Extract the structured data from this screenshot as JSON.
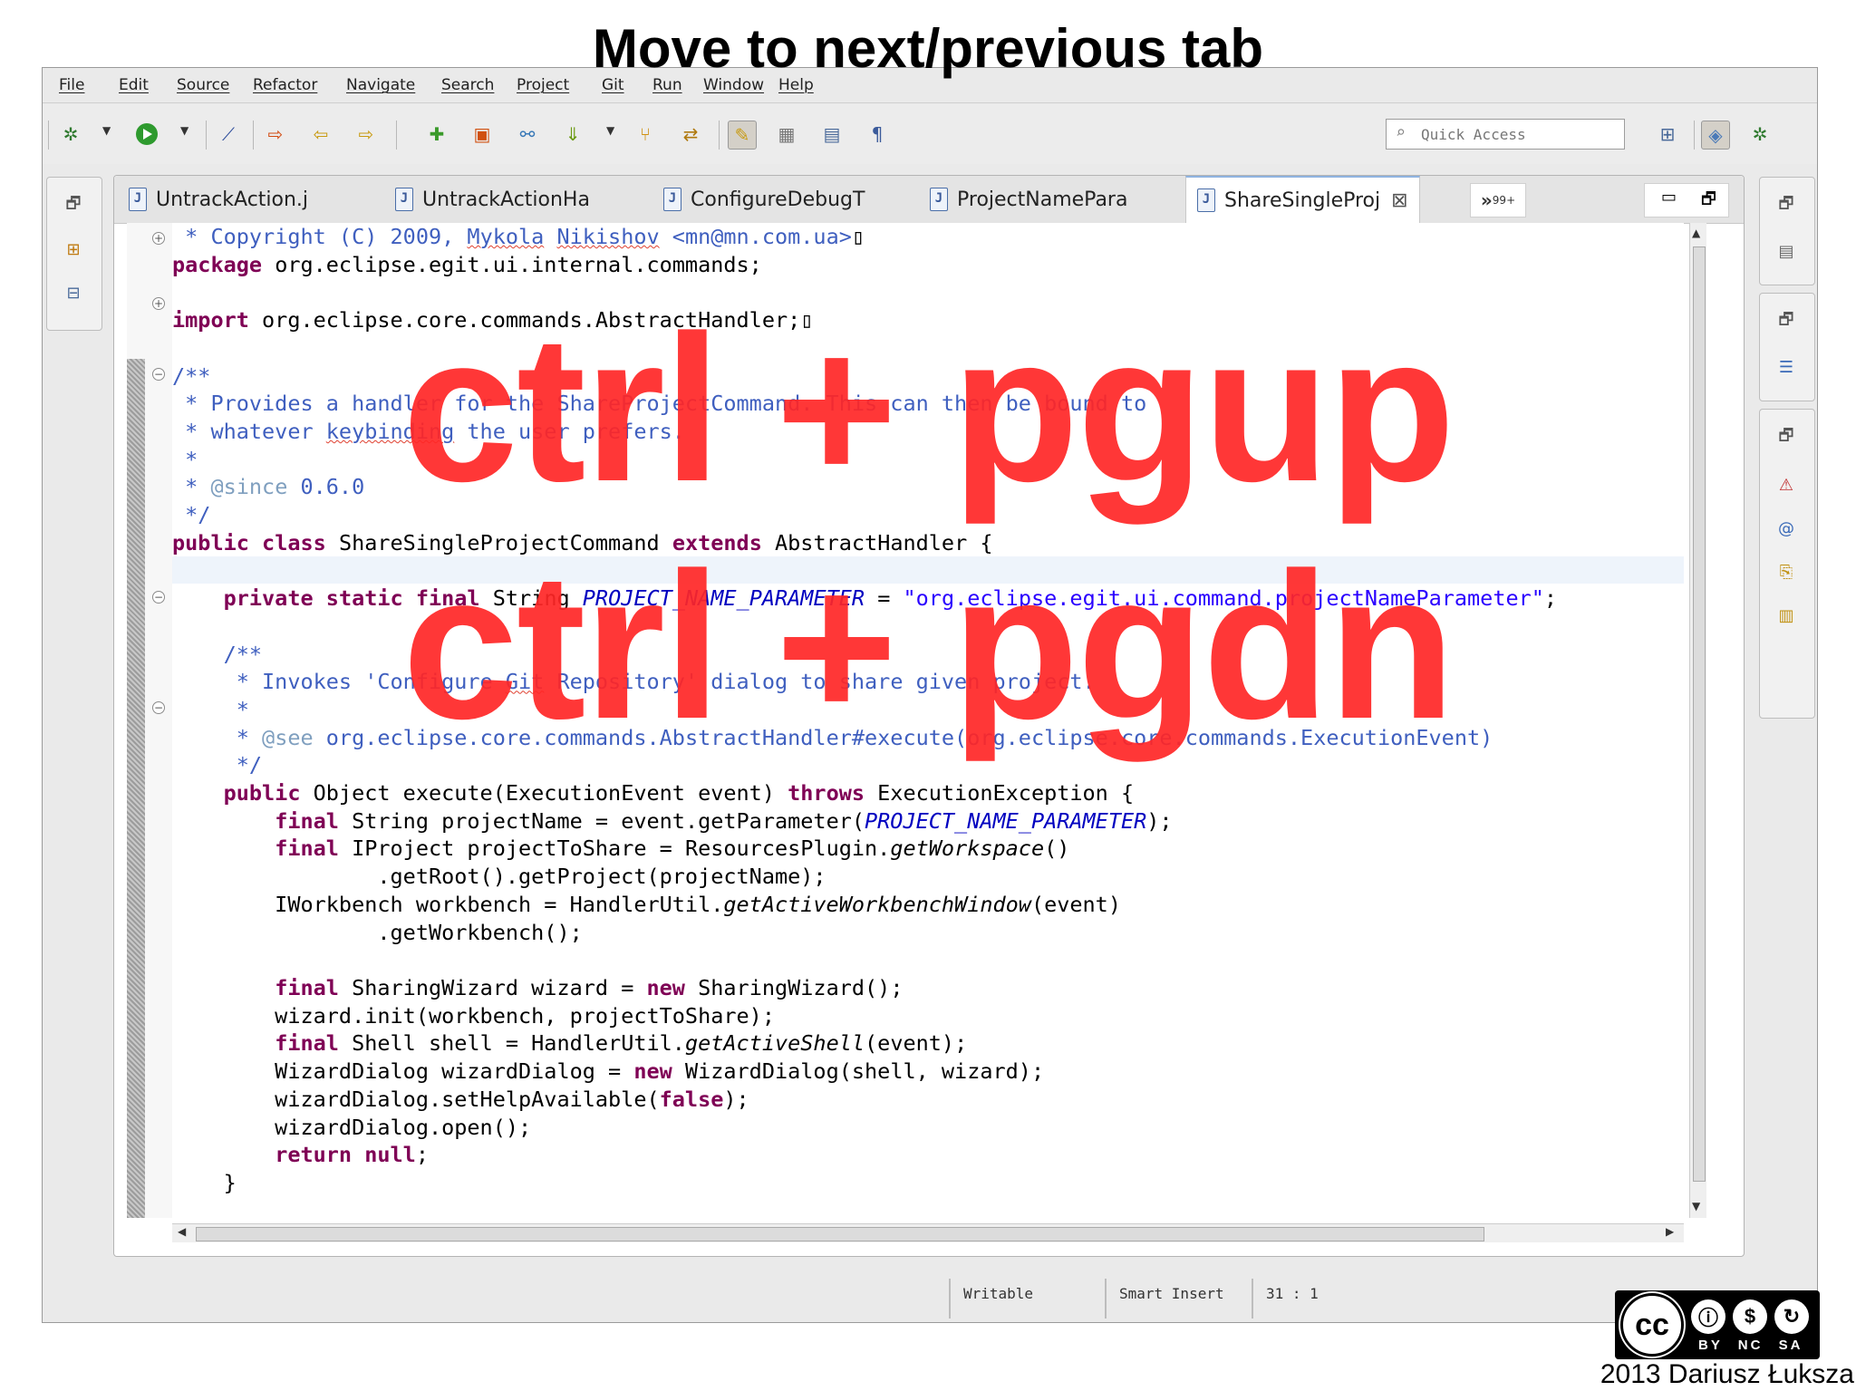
{
  "slide_title": "Move to next/previous tab",
  "menu": [
    "File",
    "Edit",
    "Source",
    "Refactor",
    "Navigate",
    "Search",
    "Project",
    "Git",
    "Run",
    "Window",
    "Help"
  ],
  "toolbar": {
    "quick_access_placeholder": "Quick Access",
    "icons": [
      "debug-icon",
      "run-icon",
      "skip-breakpoints-icon",
      "open-type-icon",
      "new-class-icon",
      "new-package-icon",
      "new-icon",
      "git-icon",
      "search-icon",
      "toggle-mark-occurrences-icon",
      "block-selection-icon",
      "show-whitespace-icon",
      "pilcrow-icon"
    ]
  },
  "tabs": [
    {
      "label": "UntrackAction.j",
      "active": false
    },
    {
      "label": "UntrackActionHa",
      "active": false
    },
    {
      "label": "ConfigureDebugT",
      "active": false
    },
    {
      "label": "ProjectNamePara",
      "active": false
    },
    {
      "label": "ShareSingleProj",
      "active": true
    }
  ],
  "tab_overflow": {
    "arrows": "»",
    "count": "99+"
  },
  "status": {
    "writable": "Writable",
    "insert_mode": "Smart Insert",
    "position": "31 : 1"
  },
  "overlay": {
    "line1": "ctrl + pgup",
    "line2": "ctrl + pgdn"
  },
  "license": {
    "cc": "cc",
    "terms": "BY NC SA"
  },
  "footer_credit": "2013 Dariusz Łuksza",
  "colors": {
    "keyword": "#7f0055",
    "comment": "#3f5fbf",
    "string": "#2a00ff",
    "field": "#0000c0",
    "overlay": "#ff2626"
  }
}
